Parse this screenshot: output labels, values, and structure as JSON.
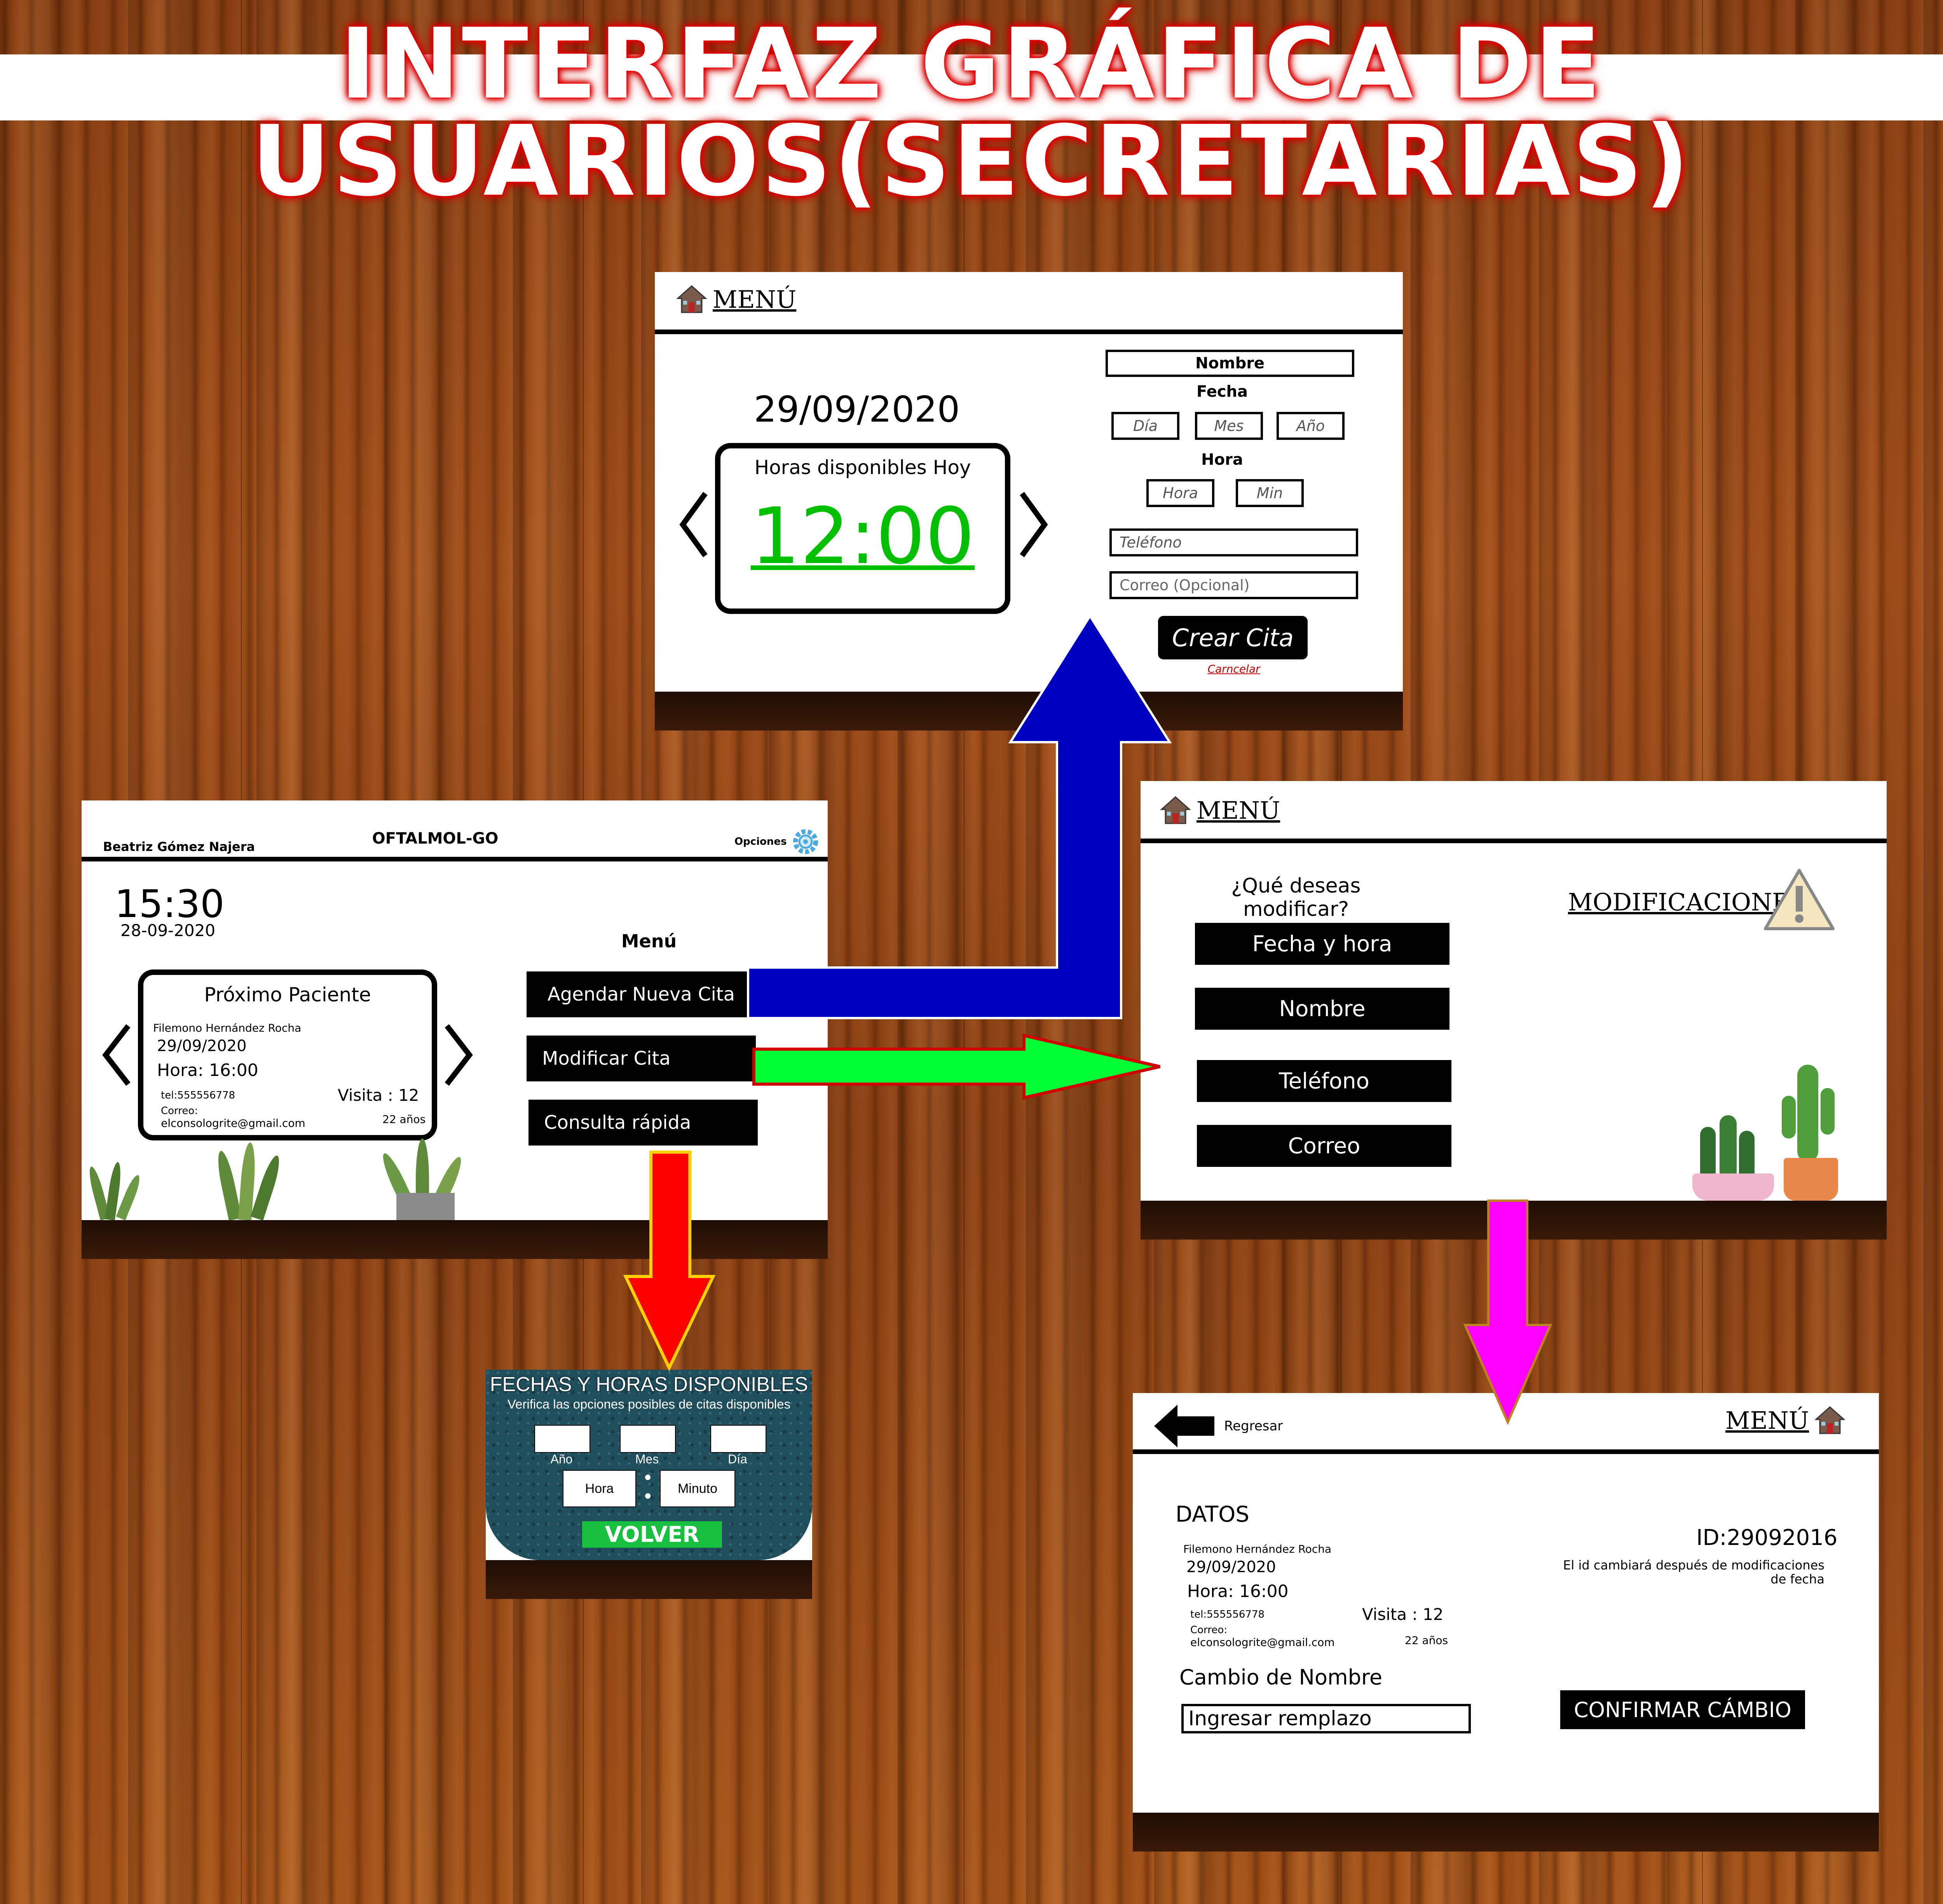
{
  "title": {
    "line1": "INTERFAZ GRÁFICA DE",
    "line2": "USUARIOS(SECRETARIAS)"
  },
  "icons": {
    "home": "home-icon",
    "gear": "gear-icon",
    "warning": "warning-icon",
    "back": "back-arrow-icon"
  },
  "colors": {
    "arrow_blue": "#0000c0",
    "arrow_green": "#00ff33",
    "arrow_red": "#ff0000",
    "arrow_magenta": "#ff00ff",
    "time_green": "#00c000",
    "volver_green": "#18c040"
  },
  "main": {
    "user": "Beatriz Gómez Najera",
    "app": "OFTALMOL-GO",
    "options": "Opciones",
    "time": "15:30",
    "date": "28-09-2020",
    "card_title": "Próximo Paciente",
    "patient_name": "Filemono Hernández Rocha",
    "patient_date": "29/09/2020",
    "patient_hour": "Hora: 16:00",
    "patient_tel": "tel:555556778",
    "patient_visit": "Visita : 12",
    "patient_mail_label": "Correo:",
    "patient_mail": "elconsologrite@gmail.com",
    "patient_age": "22 años",
    "menu_title": "Menú",
    "btn_agendar": "Agendar Nueva Cita",
    "btn_modificar": "Modificar Cita",
    "btn_consulta": "Consulta rápida"
  },
  "create": {
    "menu": "MENÚ",
    "date": "29/09/2020",
    "hours_label": "Horas disponibles Hoy",
    "hour": "12:00",
    "f_nombre": "Nombre",
    "l_fecha": "Fecha",
    "f_dia": "Día",
    "f_mes": "Mes",
    "f_anio": "Año",
    "l_hora": "Hora",
    "f_hora": "Hora",
    "f_min": "Min",
    "f_tel": "Teléfono",
    "f_correo": "Correo (Opcional)",
    "btn_crear": "Crear Cita",
    "cancel": "Carncelar"
  },
  "modify": {
    "menu": "MENÚ",
    "question": "¿Qué deseas modificar?",
    "heading": "MODIFICACIONES",
    "opt1": "Fecha y hora",
    "opt2": "Nombre",
    "opt3": "Teléfono",
    "opt4": "Correo"
  },
  "quick": {
    "title": "FECHAS Y HORAS DISPONIBLES",
    "subtitle": "Verifica las opciones posibles de citas disponibles",
    "l_anio": "Año",
    "l_mes": "Mes",
    "l_dia": "Día",
    "f_hora": "Hora",
    "f_minuto": "Minuto",
    "btn_volver": "VOLVER"
  },
  "change": {
    "back": "Regresar",
    "menu": "MENÚ",
    "datos": "DATOS",
    "patient_name": "Filemono Hernández Rocha",
    "patient_date": "29/09/2020",
    "patient_hour": "Hora: 16:00",
    "patient_tel": "tel:555556778",
    "patient_visit": "Visita : 12",
    "patient_mail_label": "Correo:",
    "patient_mail": "elconsologrite@gmail.com",
    "patient_age": "22 años",
    "id": "ID:29092016",
    "id_note": "El id cambiará después de modificaciones de fecha",
    "cambio_label": "Cambio de  Nombre",
    "input_placeholder": "Ingresar remplazo",
    "btn_confirm": "CONFIRMAR CÁMBIO"
  }
}
